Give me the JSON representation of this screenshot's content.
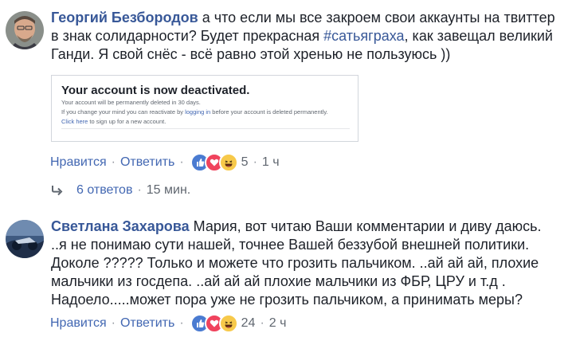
{
  "comment1": {
    "author": "Георгий Безбородов",
    "text_before_hashtag": " а что если мы все закроем свои аккаунты на твиттер в знак солидарности? Будет прекрасная ",
    "hashtag": "#сатьяграха",
    "text_after_hashtag": ", как завещал великий Ганди. Я свой снёс - всё равно этой хренью не пользуюсь ))",
    "attachment": {
      "title": "Your account is now deactivated.",
      "line1": "Your account will be permanently deleted in 30 days.",
      "line2_before": "If you change your mind you can reactivate by ",
      "line2_link": "logging in",
      "line2_after": " before your account is deleted permanently.",
      "line3_link": "Click here",
      "line3_after": " to sign up for a new account."
    },
    "actions": {
      "like": "Нравится",
      "reply": "Ответить",
      "reaction_count": "5",
      "time": "1 ч"
    },
    "replies": {
      "label": "6 ответов",
      "time": "15 мин."
    }
  },
  "comment2": {
    "author": "Светлана Захарова",
    "text": " Мария, вот читаю Ваши комментарии и диву даюсь. ..я не понимаю сути нашей, точнее Вашей беззубой внешней политики. Доколе ????? Только и можете что грозить пальчиком. ..ай ай ай, плохие мальчики из госдепа. ..ай ай ай плохие мальчики из ФБР, ЦРУ и т.д . Надоело.....может пора уже не грозить пальчиком, а принимать меры?",
    "actions": {
      "like": "Нравится",
      "reply": "Ответить",
      "reaction_count": "24",
      "time": "2 ч"
    }
  },
  "separator": "·",
  "colors": {
    "link": "#4267b2",
    "author": "#385898",
    "meta": "#606770"
  }
}
